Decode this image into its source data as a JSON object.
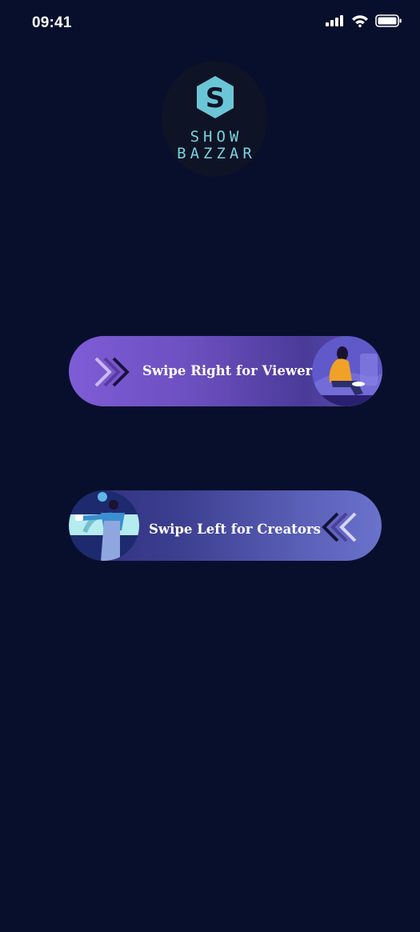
{
  "status_bar": {
    "time": "09:41",
    "icons": [
      "signal-icon",
      "wifi-icon",
      "battery-icon"
    ]
  },
  "logo": {
    "letter": "S",
    "line1": "SHOW",
    "line2": "BAZZAR"
  },
  "buttons": {
    "viewers": {
      "label": "Swipe Right for Viewers"
    },
    "creators": {
      "label": "Swipe Left for Creators"
    }
  },
  "colors": {
    "background": "#080f2c",
    "logo_accent": "#7ad3e0",
    "viewers_gradient_start": "#7e5cd6",
    "creators_gradient_end": "#6a72cc"
  }
}
